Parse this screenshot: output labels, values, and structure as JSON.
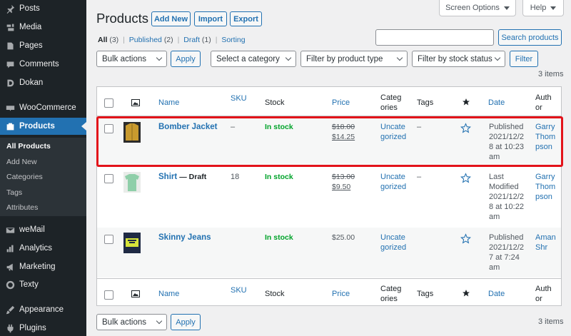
{
  "sidebar": {
    "items": [
      {
        "label": "Posts",
        "icon": "pin-icon"
      },
      {
        "label": "Media",
        "icon": "media-icon"
      },
      {
        "label": "Pages",
        "icon": "pages-icon"
      },
      {
        "label": "Comments",
        "icon": "comments-icon"
      },
      {
        "label": "Dokan",
        "icon": "dokan-icon"
      },
      {
        "label": "WooCommerce",
        "icon": "woocommerce-icon"
      },
      {
        "label": "Products",
        "icon": "products-icon"
      },
      {
        "label": "weMail",
        "icon": "wemail-icon"
      },
      {
        "label": "Analytics",
        "icon": "analytics-icon"
      },
      {
        "label": "Marketing",
        "icon": "marketing-icon"
      },
      {
        "label": "Texty",
        "icon": "texty-icon"
      },
      {
        "label": "Appearance",
        "icon": "appearance-icon"
      },
      {
        "label": "Plugins",
        "icon": "plugins-icon"
      }
    ],
    "submenu": [
      "All Products",
      "Add New",
      "Categories",
      "Tags",
      "Attributes"
    ]
  },
  "top_tabs": {
    "screen_options": "Screen Options",
    "help": "Help"
  },
  "header": {
    "title": "Products",
    "add_new": "Add New",
    "import": "Import",
    "export": "Export"
  },
  "subsubsub": {
    "all": "All",
    "all_count": "(3)",
    "published": "Published",
    "published_count": "(2)",
    "draft": "Draft",
    "draft_count": "(1)",
    "sorting": "Sorting"
  },
  "search": {
    "value": "",
    "button": "Search products"
  },
  "filters": {
    "bulk_actions": "Bulk actions",
    "apply": "Apply",
    "category": "Select a category",
    "product_type": "Filter by product type",
    "stock_status": "Filter by stock status",
    "filter_button": "Filter"
  },
  "items_count": "3 items",
  "columns": {
    "name": "Name",
    "sku": "SKU",
    "stock": "Stock",
    "price": "Price",
    "categories_1": "Categ",
    "categories_2": "ories",
    "tags": "Tags",
    "date": "Date",
    "author_1": "Auth",
    "author_2": "or"
  },
  "products": [
    {
      "name": "Bomber Jacket",
      "status": "",
      "sku": "–",
      "stock": "In stock",
      "old_price": "$18.00",
      "price": "$14.25",
      "category_1": "Uncate",
      "category_2": "gorized",
      "tags": "–",
      "date_1": "Published",
      "date_2": "2021/12/2",
      "date_3": "8 at 10:23",
      "date_4": "am",
      "author_1": "Garry",
      "author_2": "Thom",
      "author_3": "pson",
      "thumb_color": "#c99a2e"
    },
    {
      "name": "Shirt",
      "status": "— Draft",
      "sku": "18",
      "stock": "In stock",
      "old_price": "$13.00",
      "price": "$9.50",
      "category_1": "Uncate",
      "category_2": "gorized",
      "tags": "–",
      "date_1": "Last",
      "date_2": "Modified",
      "date_3": "2021/12/2",
      "date_4": "8 at 10:22",
      "date_5": "am",
      "author_1": "Garry",
      "author_2": "Thom",
      "author_3": "pson",
      "thumb_color": "#8fcfa9"
    },
    {
      "name": "Skinny Jeans",
      "status": "",
      "sku": "",
      "stock": "In stock",
      "old_price": "",
      "price": "$25.00",
      "category_1": "Uncate",
      "category_2": "gorized",
      "tags": "",
      "date_1": "Published",
      "date_2": "2021/12/2",
      "date_3": "7 at 7:24",
      "date_4": "am",
      "author_1": "Aman",
      "author_2": "Shr",
      "thumb_color": "#1f2a44"
    }
  ],
  "colors": {
    "accent": "#2271b1",
    "sidebar_bg": "#1d2327",
    "in_stock": "#00a32a",
    "highlight": "#e3131a"
  }
}
